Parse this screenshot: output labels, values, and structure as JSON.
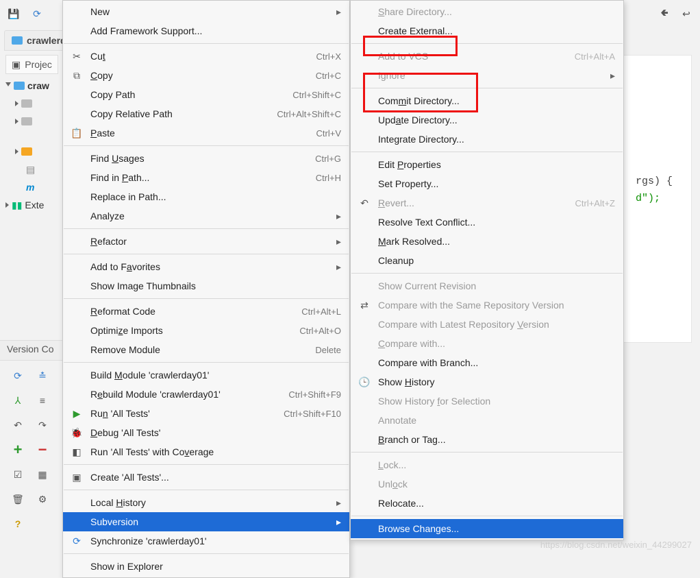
{
  "toolbar": {
    "project_tab": "crawlerda"
  },
  "project_panel": {
    "label": "Projec"
  },
  "tree": {
    "root": "craw",
    "m_label": "m",
    "ext_label": "Exte"
  },
  "vcs_bar": {
    "label": "Version Co"
  },
  "code": {
    "line1": "rgs) {",
    "line2": "d\");"
  },
  "watermark": "https://blog.csdn.net/weixin_44299027",
  "menu1": [
    {
      "t": "item",
      "label": "New",
      "arrow": true
    },
    {
      "t": "item",
      "label": "Add Framework Support..."
    },
    {
      "t": "sep"
    },
    {
      "t": "item",
      "icon": "scissors",
      "label": "Cu<u>t</u>",
      "sc": "Ctrl+X"
    },
    {
      "t": "item",
      "icon": "copy",
      "label": "<u>C</u>opy",
      "sc": "Ctrl+C"
    },
    {
      "t": "item",
      "label": "Copy Path",
      "sc": "Ctrl+Shift+C"
    },
    {
      "t": "item",
      "label": "Copy Relative Path",
      "sc": "Ctrl+Alt+Shift+C"
    },
    {
      "t": "item",
      "icon": "paste",
      "label": "<u>P</u>aste",
      "sc": "Ctrl+V"
    },
    {
      "t": "sep"
    },
    {
      "t": "item",
      "label": "Find <u>U</u>sages",
      "sc": "Ctrl+G"
    },
    {
      "t": "item",
      "label": "Find in <u>P</u>ath...",
      "sc": "Ctrl+H"
    },
    {
      "t": "item",
      "label": "Replace in Path..."
    },
    {
      "t": "item",
      "label": "Analyze",
      "arrow": true
    },
    {
      "t": "sep"
    },
    {
      "t": "item",
      "label": "<u>R</u>efactor",
      "arrow": true
    },
    {
      "t": "sep"
    },
    {
      "t": "item",
      "label": "Add to F<u>a</u>vorites",
      "arrow": true
    },
    {
      "t": "item",
      "label": "Show Image Thumbnails"
    },
    {
      "t": "sep"
    },
    {
      "t": "item",
      "label": "<u>R</u>eformat Code",
      "sc": "Ctrl+Alt+L"
    },
    {
      "t": "item",
      "label": "Optimi<u>z</u>e Imports",
      "sc": "Ctrl+Alt+O"
    },
    {
      "t": "item",
      "label": "Remove Module",
      "sc": "Delete"
    },
    {
      "t": "sep"
    },
    {
      "t": "item",
      "label": "Build <u>M</u>odule 'crawlerday01'"
    },
    {
      "t": "item",
      "label": "R<u>e</u>build Module 'crawlerday01'",
      "sc": "Ctrl+Shift+F9"
    },
    {
      "t": "item",
      "icon": "play",
      "label": "Ru<u>n</u> 'All Tests'",
      "sc": "Ctrl+Shift+F10"
    },
    {
      "t": "item",
      "icon": "bug",
      "label": "<u>D</u>ebug 'All Tests'"
    },
    {
      "t": "item",
      "icon": "cover",
      "label": "Run 'All Tests' with Co<u>v</u>erage"
    },
    {
      "t": "sep"
    },
    {
      "t": "item",
      "icon": "gear",
      "label": "Create 'All Tests'..."
    },
    {
      "t": "sep"
    },
    {
      "t": "item",
      "label": "Local <u>H</u>istory",
      "arrow": true
    },
    {
      "t": "item",
      "label": "Subversion",
      "arrow": true,
      "selected": true
    },
    {
      "t": "item",
      "icon": "sync",
      "label": "Synchronize 'crawlerday01'"
    },
    {
      "t": "sep"
    },
    {
      "t": "item",
      "label": "Show in Explorer"
    }
  ],
  "menu2": [
    {
      "t": "item",
      "label": "<u>S</u>hare Directory...",
      "disabled": true
    },
    {
      "t": "item",
      "label": "Create External..."
    },
    {
      "t": "sep"
    },
    {
      "t": "item",
      "label": "Add to VCS",
      "sc": "Ctrl+Alt+A",
      "disabled": true
    },
    {
      "t": "item",
      "label": "Ignore",
      "arrow": true,
      "disabled": true
    },
    {
      "t": "sep"
    },
    {
      "t": "item",
      "label": "Com<u>m</u>it Directory..."
    },
    {
      "t": "item",
      "label": "Upd<u>a</u>te Directory..."
    },
    {
      "t": "item",
      "label": "Integrate Directory..."
    },
    {
      "t": "sep"
    },
    {
      "t": "item",
      "label": "Edit <u>P</u>roperties"
    },
    {
      "t": "item",
      "label": "Set Property..."
    },
    {
      "t": "item",
      "icon": "revert",
      "label": "<u>R</u>evert...",
      "sc": "Ctrl+Alt+Z",
      "disabled": true
    },
    {
      "t": "item",
      "label": "Resolve Text Conflict..."
    },
    {
      "t": "item",
      "label": "<u>M</u>ark Resolved..."
    },
    {
      "t": "item",
      "label": "Cleanup"
    },
    {
      "t": "sep"
    },
    {
      "t": "item",
      "label": "Show Current Revision",
      "disabled": true
    },
    {
      "t": "item",
      "icon": "diff",
      "label": "Compare with the Same Repository Version",
      "disabled": true
    },
    {
      "t": "item",
      "label": "Compare with Latest Repository <u>V</u>ersion",
      "disabled": true
    },
    {
      "t": "item",
      "label": "<u>C</u>ompare with...",
      "disabled": true
    },
    {
      "t": "item",
      "label": "Compare with Branch..."
    },
    {
      "t": "item",
      "icon": "history",
      "label": "Show <u>H</u>istory"
    },
    {
      "t": "item",
      "label": "Show History <u>f</u>or Selection",
      "disabled": true
    },
    {
      "t": "item",
      "label": "Annotate",
      "disabled": true
    },
    {
      "t": "item",
      "label": "<u>B</u>ranch or Tag..."
    },
    {
      "t": "sep"
    },
    {
      "t": "item",
      "label": "<u>L</u>ock...",
      "disabled": true
    },
    {
      "t": "item",
      "label": "Unl<u>o</u>ck",
      "disabled": true
    },
    {
      "t": "item",
      "label": "Relocate..."
    },
    {
      "t": "sep"
    },
    {
      "t": "item",
      "label": "Browse Changes...",
      "selected": true
    }
  ]
}
